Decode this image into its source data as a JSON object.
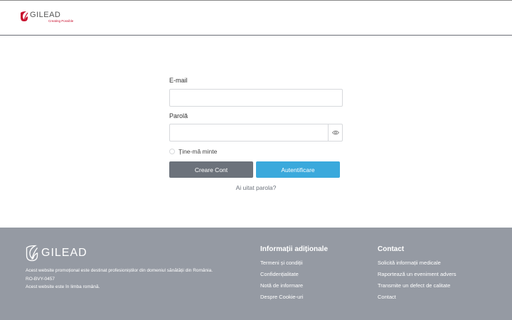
{
  "header": {
    "logo_word": "GILEAD",
    "logo_tagline": "Creating Possible"
  },
  "form": {
    "email_label": "E-mail",
    "email_value": "",
    "password_label": "Parolă",
    "password_value": "",
    "remember_label": "Ține-mă minte",
    "remember_checked": false,
    "create_button": "Creare Cont",
    "login_button": "Autentificare",
    "forgot_link": "Ai uitat parola?"
  },
  "footer": {
    "logo_word": "GILEAD",
    "text_1": "Acest website promoțional este destinat profesioniștilor din domeniul sănătății din România.",
    "text_2": "RO-BVY-0457",
    "text_3": "Acest website este în limba română.",
    "col1": {
      "heading": "Informații adiționale",
      "links": [
        "Termeni și condiții",
        "Confidențialitate",
        "Notă de informare",
        "Despre Cookie-uri"
      ]
    },
    "col2": {
      "heading": "Contact",
      "links": [
        "Solicită informații medicale",
        "Raportează un eveniment advers",
        "Transmite un defect de calitate",
        "Contact"
      ]
    }
  },
  "colors": {
    "brand_red": "#c8102e",
    "create_button_bg": "#6c727b",
    "login_button_bg": "#3aa9dc",
    "footer_bg": "#959aa3"
  },
  "icons": {
    "logo": "gilead-leaf-icon",
    "password_toggle": "eye-icon"
  }
}
